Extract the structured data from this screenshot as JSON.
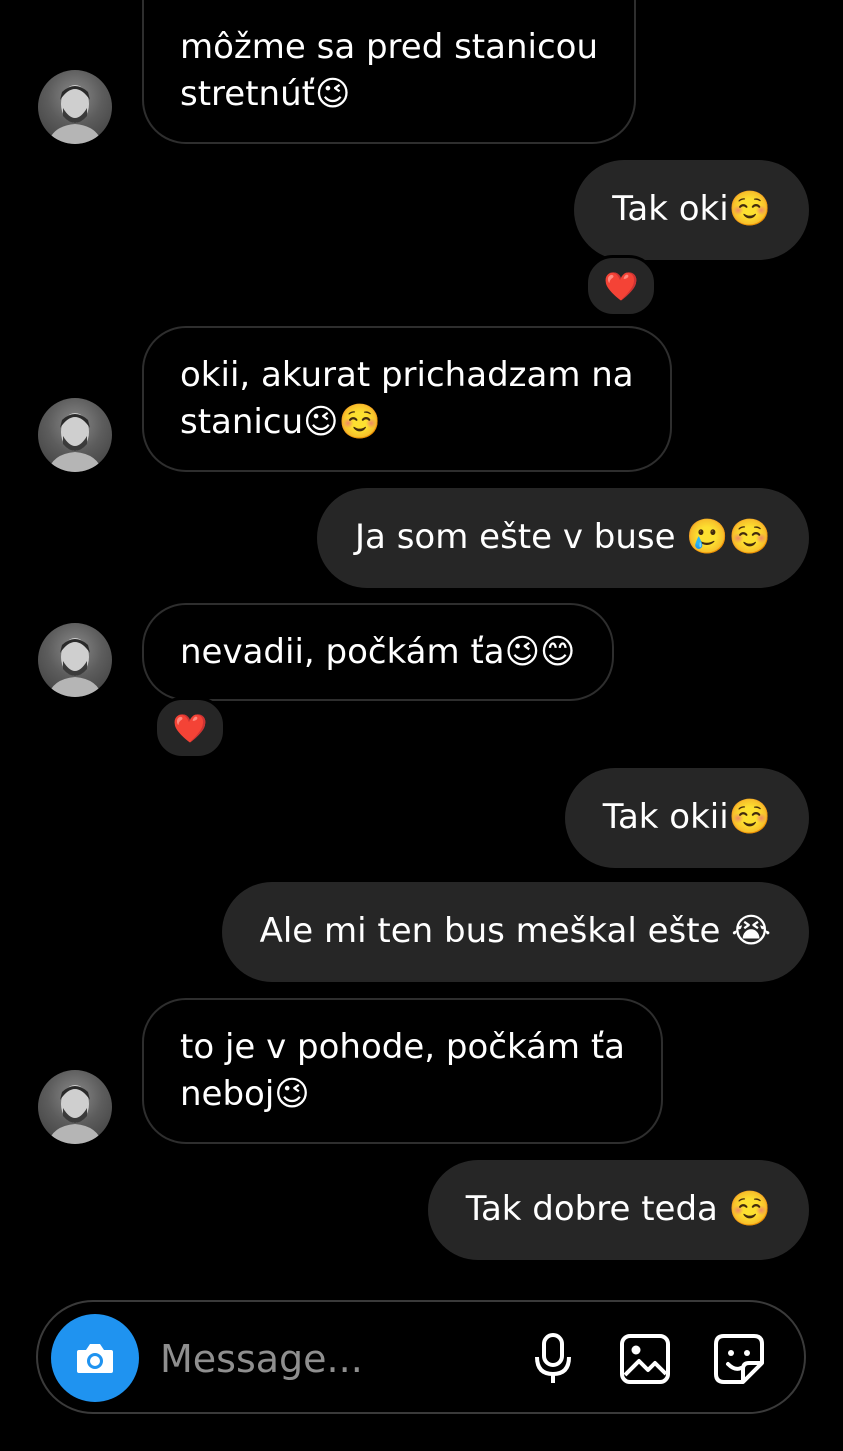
{
  "messages": [
    {
      "id": 1,
      "side": "in",
      "text": "môžme sa pred stanicou",
      "text2": "stretnúť😉"
    },
    {
      "id": 2,
      "side": "out",
      "text": "Tak oki☺️",
      "reaction": "❤️"
    },
    {
      "id": 3,
      "side": "in",
      "text": "okii, akurat prichadzam na",
      "text2": "stanicu😉☺️"
    },
    {
      "id": 4,
      "side": "out",
      "text": "Ja som ešte v buse 🥲☺️"
    },
    {
      "id": 5,
      "side": "in",
      "text": "nevadii, počkám ťa😉😊",
      "reaction": "❤️"
    },
    {
      "id": 6,
      "side": "out",
      "text": "Tak okii☺️"
    },
    {
      "id": 7,
      "side": "out",
      "text": "Ale mi ten bus meškal ešte 😭"
    },
    {
      "id": 8,
      "side": "in",
      "text": "to je v pohode, počkám ťa",
      "text2": "neboj😉"
    },
    {
      "id": 9,
      "side": "out",
      "text": "Tak dobre teda ☺️"
    }
  ],
  "composer": {
    "placeholder": "Message...",
    "icons": [
      "camera-icon",
      "microphone-icon",
      "gallery-icon",
      "sticker-icon"
    ]
  },
  "colors": {
    "background": "#000000",
    "outgoing_bubble": "#262626",
    "incoming_border": "#2e2e2e",
    "camera_button": "#1f93f0"
  }
}
